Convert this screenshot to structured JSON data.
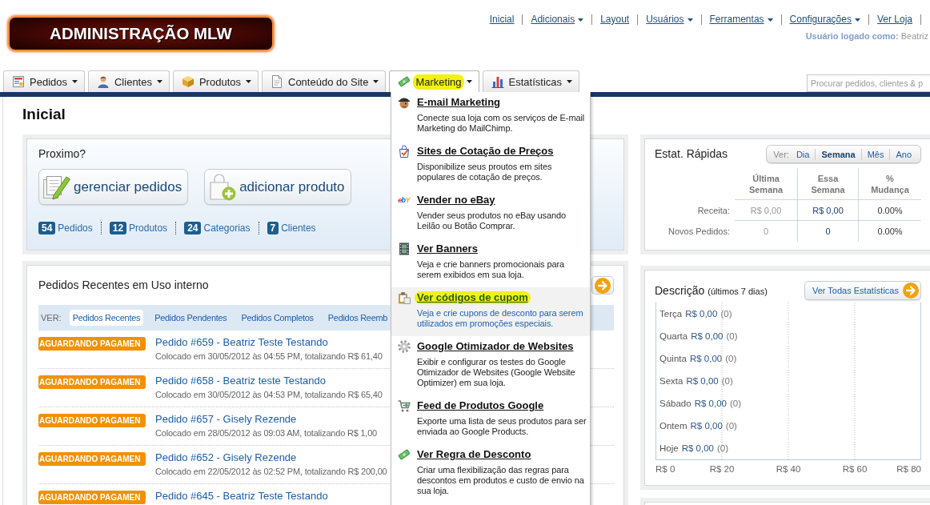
{
  "header": {
    "logo": "ADMINISTRAÇÃO MLW",
    "links": [
      {
        "label": "Inicial",
        "dropdown": false
      },
      {
        "label": "Adicionais",
        "dropdown": true
      },
      {
        "label": "Layout",
        "dropdown": false
      },
      {
        "label": "Usuários",
        "dropdown": true
      },
      {
        "label": "Ferramentas",
        "dropdown": true
      },
      {
        "label": "Configurações",
        "dropdown": true
      },
      {
        "label": "Ver Loja",
        "dropdown": false
      }
    ],
    "user_label": "Usuário logado como:",
    "user_name": "Beatriz"
  },
  "nav": {
    "tabs": [
      {
        "label": "Pedidos",
        "selected": false,
        "highlighted": false
      },
      {
        "label": "Clientes",
        "selected": false,
        "highlighted": false
      },
      {
        "label": "Produtos",
        "selected": false,
        "highlighted": false
      },
      {
        "label": "Conteúdo do Site",
        "selected": false,
        "highlighted": false
      },
      {
        "label": "Marketing",
        "selected": true,
        "highlighted": true
      },
      {
        "label": "Estatísticas",
        "selected": false,
        "highlighted": false
      }
    ],
    "search": {
      "placeholder": "Procurar pedidos, clientes & p"
    }
  },
  "page_title": "Inicial",
  "next_steps": {
    "title": "Proximo?",
    "buttons": [
      "gerenciar pedidos",
      "adicionar produto"
    ],
    "counts": [
      {
        "count": "54",
        "label": "Pedidos"
      },
      {
        "count": "12",
        "label": "Produtos"
      },
      {
        "count": "24",
        "label": "Categorias"
      },
      {
        "count": "7",
        "label": "Clientes"
      }
    ]
  },
  "recent_orders": {
    "title": "Pedidos Recentes em Uso interno",
    "filter_label": "VER:",
    "filters": [
      {
        "label": "Pedidos Recentes",
        "selected": true
      },
      {
        "label": "Pedidos Pendentes",
        "selected": false
      },
      {
        "label": "Pedidos Completos",
        "selected": false
      },
      {
        "label": "Pedidos Reemb",
        "selected": false
      }
    ],
    "orders": [
      {
        "status": "AGUARDANDO PAGAMEN",
        "title": "Pedido #659 - Beatriz Teste Testando",
        "details": "Colocado em 30/05/2012 às 04:55 PM, totalizando R$ 61,40"
      },
      {
        "status": "AGUARDANDO PAGAMEN",
        "title": "Pedido #658 - Beatriz teste Testando",
        "details": "Colocado em 30/05/2012 às 04:53 PM, totalizando R$ 65,40"
      },
      {
        "status": "AGUARDANDO PAGAMEN",
        "title": "Pedido #657 - Gisely Rezende",
        "details": "Colocado em 28/05/2012 às 09:03 AM, totalizando R$ 1,00"
      },
      {
        "status": "AGUARDANDO PAGAMEN",
        "title": "Pedido #652 - Gisely Rezende",
        "details": "Colocado em 22/05/2012 às 02:52 PM, totalizando R$ 200,00"
      },
      {
        "status": "AGUARDANDO PAGAMEN",
        "title": "Pedido #645 - Beatriz Teste Testando"
      }
    ]
  },
  "marketing_menu": {
    "items": [
      {
        "title": "E-mail Marketing",
        "description": "Conecte sua loja com os serviços de E-mail Marketing do MailChimp.",
        "selected": false,
        "highlighted": false
      },
      {
        "title": "Sites de Cotação de Preços",
        "description": "Disponibilize seus proutos em sites populares de cotação de preços.",
        "selected": false,
        "highlighted": false
      },
      {
        "title": "Vender no eBay",
        "description": "Vender seus produtos no eBay usando Leilão ou Botão Comprar.",
        "logo": "ebY",
        "selected": false,
        "highlighted": false
      },
      {
        "title": "Ver Banners",
        "description": "Veja e crie banners promocionais para serem exibidos em sua loja.",
        "selected": false,
        "highlighted": false
      },
      {
        "title": "Ver códigos de cupom",
        "description": "Veja e crie cupons de desconto para serem utilizados em promoções especiais.",
        "selected": true,
        "highlighted": true
      },
      {
        "title": "Google Otimizador de Websites",
        "description": "Exibir e configurar os testes do Google Otimizador de Websites (Google Website Optimizer) em sua loja.",
        "selected": false,
        "highlighted": false
      },
      {
        "title": "Feed de Produtos Google",
        "description": "Exporte uma lista de seus produtos para ser enviada ao Google Products.",
        "selected": false,
        "highlighted": false
      },
      {
        "title": "Ver Regra de Desconto",
        "description": "Criar uma flexibilização das regras para descontos em produtos e custo de envio na sua loja.",
        "selected": false,
        "highlighted": false
      }
    ]
  },
  "quick_stats": {
    "title": "Estat. Rápidas",
    "period_label": "Ver:",
    "periods": [
      {
        "label": "Dia",
        "selected": false
      },
      {
        "label": "Semana",
        "selected": true
      },
      {
        "label": "Mês",
        "selected": false
      },
      {
        "label": "Ano",
        "selected": false
      }
    ],
    "columns": [
      "Última Semana",
      "Essa Semana",
      "% Mudança"
    ],
    "rows": [
      {
        "label": "Receita:",
        "values": [
          "R$ 0,00",
          "R$ 0,00",
          "0.00%"
        ]
      },
      {
        "label": "Novos Pedidos:",
        "values": [
          "0",
          "0",
          "0.00%"
        ]
      }
    ]
  },
  "overview": {
    "title": "Descrição",
    "subtitle": "(últimos 7 dias)",
    "button": "Ver Todas Estatísticas",
    "days": [
      {
        "day": "Terça",
        "amount": "R$ 0,00",
        "count": "(0)"
      },
      {
        "day": "Quarta",
        "amount": "R$ 0,00",
        "count": "(0)"
      },
      {
        "day": "Quinta",
        "amount": "R$ 0,00",
        "count": "(0)"
      },
      {
        "day": "Sexta",
        "amount": "R$ 0,00",
        "count": "(0)"
      },
      {
        "day": "Sábado",
        "amount": "R$ 0,00",
        "count": "(0)"
      },
      {
        "day": "Ontem",
        "amount": "R$ 0,00",
        "count": "(0)"
      },
      {
        "day": "Hoje",
        "amount": "R$ 0,00",
        "count": "(0)"
      }
    ],
    "axis_labels": [
      "R$ 0",
      "R$ 20",
      "R$ 40",
      "R$ 60",
      "R$ 80"
    ]
  }
}
